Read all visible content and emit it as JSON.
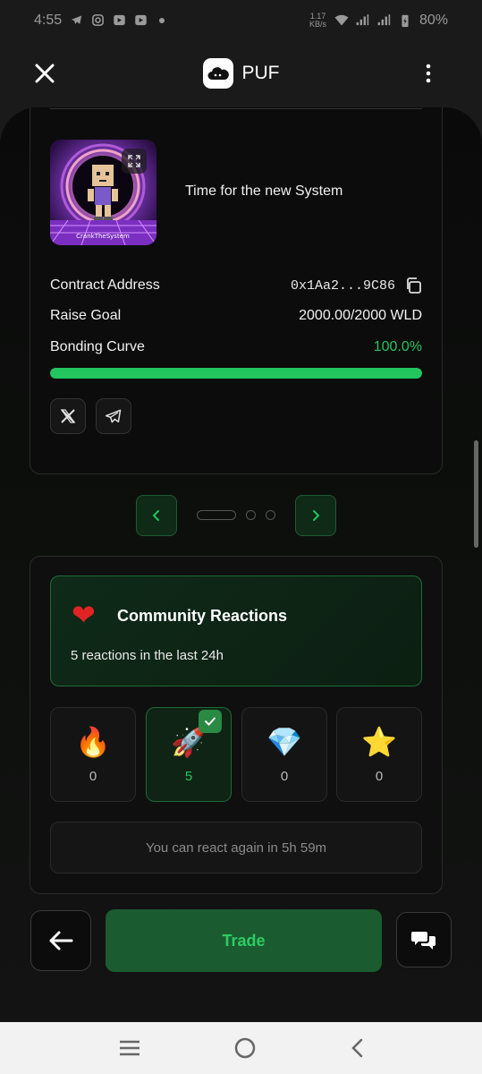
{
  "status_bar": {
    "time": "4:55",
    "speed_value": "1.17",
    "speed_unit": "KB/s",
    "battery": "80%"
  },
  "header": {
    "title": "PUF",
    "close_icon": "close-icon",
    "menu_icon": "more-vertical-icon"
  },
  "token": {
    "image_caption": "CrankTheSystem",
    "description": "Time for the new System",
    "contract_label": "Contract Address",
    "contract_value": "0x1Aa2...9C86",
    "raise_label": "Raise Goal",
    "raise_value": "2000.00/2000 WLD",
    "curve_label": "Bonding Curve",
    "curve_value": "100.0%",
    "curve_progress": 1.0,
    "socials": [
      "x-icon",
      "telegram-icon"
    ]
  },
  "carousel": {
    "prev_icon": "chevron-left-icon",
    "next_icon": "chevron-right-icon",
    "pages": 3,
    "active": 0
  },
  "reactions": {
    "title": "Community Reactions",
    "summary": "5 reactions in the last 24h",
    "items": [
      {
        "emoji": "🔥",
        "name": "fire",
        "count": "0"
      },
      {
        "emoji": "🚀",
        "name": "rocket",
        "count": "5",
        "active": true
      },
      {
        "emoji": "💎",
        "name": "gem",
        "count": "0"
      },
      {
        "emoji": "⭐",
        "name": "star",
        "count": "0"
      }
    ],
    "cooldown": "You can react again in 5h 59m"
  },
  "actions": {
    "trade_label": "Trade"
  },
  "colors": {
    "accent": "#22c55e",
    "background": "#0b0d0b"
  }
}
